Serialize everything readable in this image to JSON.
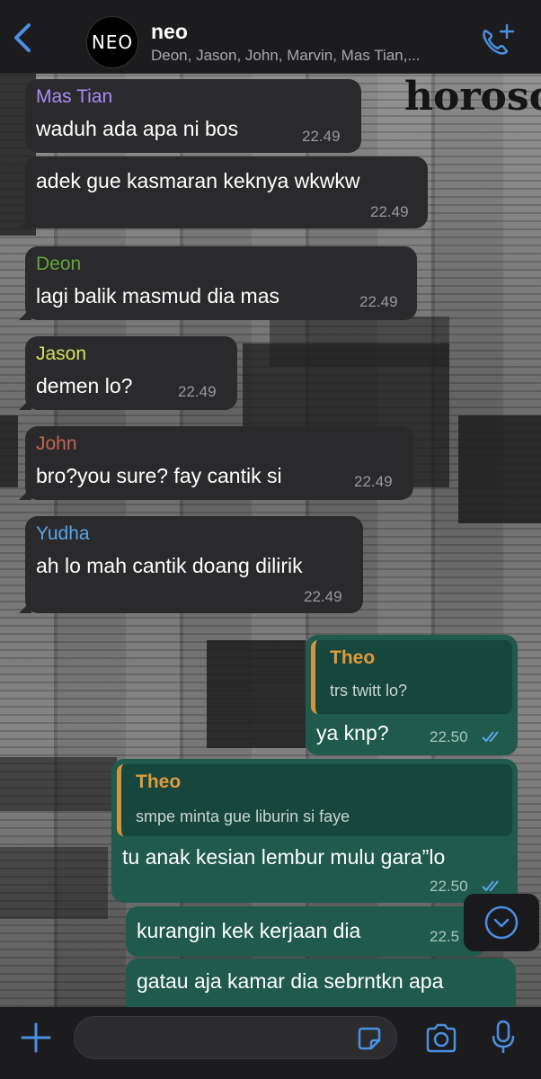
{
  "header": {
    "title": "neo",
    "members": "Deon, Jason, John, Marvin, Mas Tian,...",
    "avatar_text": "NEO"
  },
  "colors": {
    "accent": "#4a90e2",
    "incoming_bubble": "#2a2a2c",
    "outgoing_bubble": "#1f5a4c",
    "quote_bar": "#d4943b"
  },
  "messages": [
    {
      "sender": "Mas Tian",
      "sender_color": "#a98cf5",
      "text": "waduh ada apa ni bos",
      "time": "22.49"
    },
    {
      "text": "adek gue kasmaran keknya wkwkw",
      "time": "22.49"
    },
    {
      "sender": "Deon",
      "sender_color": "#63a537",
      "text": "lagi balik masmud dia mas",
      "time": "22.49"
    },
    {
      "sender": "Jason",
      "sender_color": "#d3e05a",
      "text": "demen lo?",
      "time": "22.49"
    },
    {
      "sender": "John",
      "sender_color": "#c4634f",
      "text": "bro?you sure? fay cantik si",
      "time": "22.49"
    },
    {
      "sender": "Yudha",
      "sender_color": "#5aa5e8",
      "text": "ah lo mah cantik doang dilirik",
      "time": "22.49"
    },
    {
      "quote_name": "Theo",
      "quote_text": "trs twitt lo?",
      "text": "ya knp?",
      "time": "22.50"
    },
    {
      "quote_name": "Theo",
      "quote_text": "smpe minta gue liburin si faye",
      "text": "tu anak kesian lembur mulu gara”lo",
      "time": "22.50"
    },
    {
      "text": "kurangin kek kerjaan dia",
      "time": "22.5"
    },
    {
      "text": "gatau aja kamar dia sebrntkn apa",
      "time": ""
    }
  ],
  "input": {
    "placeholder": ""
  },
  "icons": {
    "back": "chevron-left-icon",
    "call": "phone-plus-icon",
    "plus": "plus-icon",
    "sticker": "sticker-icon",
    "camera": "camera-icon",
    "mic": "microphone-icon",
    "scroll": "chevron-down-circle-icon"
  }
}
